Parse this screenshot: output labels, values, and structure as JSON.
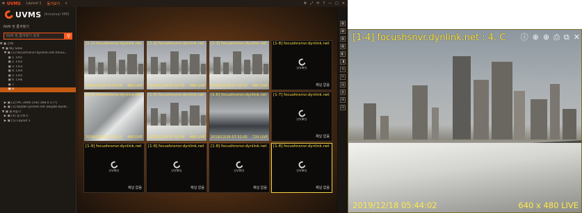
{
  "topbar": {
    "brand": "UVMS",
    "tabs": [
      {
        "label": "Layout 1",
        "active": false
      },
      {
        "label": "동기보기",
        "active": true
      }
    ],
    "add_tab": "+",
    "window_controls": [
      "⚙",
      "⤢",
      "⟳",
      "?",
      "—",
      "□",
      "✕"
    ]
  },
  "sidebar": {
    "logo_text": "UVMS",
    "logo_sub": "Universal VMS",
    "section_label": "NVR 및 즐겨찾기",
    "search_placeholder": "NVR 및 즐겨찾기 검색",
    "tree": [
      "▼ ▣ 전체",
      "  ▼ ▣ My Sites",
      "    ▼ ▣ [1] focushnsnvr.dynlink.net (focus...",
      "        ▣ 1. CH1",
      "        ▣ 2. CH2",
      "        ▣ 3. CH3",
      "        ▣ 4. CH4",
      "        ▣ 5. CH5",
      "        ▣ 6. CH6",
      "        ▣ 7.",
      "        ▣ 8.",
      "",
      "",
      "    ▶ ▣ [2] IPC-3000 (192.168.0.177)",
      "    ▶ ▣ [3] bkjdat.synheit.net (bkjdat.dynlk...",
      "  ▼ ▣ 즐겨찾기",
      "    ▶ ▣ [4] 동기보기",
      "    ▶ ▣ [5] Layout 1"
    ],
    "selected_index": 10
  },
  "grid": {
    "cells": [
      {
        "title": "[1-1] focushnsnvr.dynlink.net",
        "time": "2019/12/26 07:52:05",
        "res": "480 LIVE",
        "kind": "rooftop"
      },
      {
        "title": "[1-2] focushnsnvr.dynlink.net",
        "time": "2019/12/26 07:52:05",
        "res": "480 LIVE",
        "kind": "rooftop"
      },
      {
        "title": "[1-3] focushnsnvr.dynlink.net",
        "time": "2019/12/26 07:52:05",
        "res": "480 LIVE",
        "kind": "rooftop"
      },
      {
        "title": "[1-8] focushnsnvr.dynlink.net",
        "nosignal": "채널 없음",
        "kind": "empty"
      },
      {
        "title": "[1-5] focushnsnvr.dynlink.net",
        "time": "2019/12/26 07:52:05",
        "res": "480 LIVE",
        "kind": "indoor"
      },
      {
        "title": "[1-5] focushnsnvr.dynlink.net",
        "time": "2019/12/26 07:52:05",
        "res": "480 LIVE",
        "kind": "rooftop"
      },
      {
        "title": "[1-6] focushnsnvr.dynlink.net",
        "time": "2019/12/26 07:52:05",
        "res": "720 LIVE",
        "kind": "office"
      },
      {
        "title": "[1-7] focushnsnvr.dynlink.net",
        "nosignal": "채널 없음",
        "kind": "empty"
      },
      {
        "title": "[1-9] focushnsnvr.dynlink.net",
        "nosignal": "채널 없음",
        "kind": "empty"
      },
      {
        "title": "[1-9] focushnsnvr.dynlink.net",
        "nosignal": "채널 없음",
        "kind": "empty"
      },
      {
        "title": "[1-8] focushnsnvr.dynlink.net",
        "nosignal": "채널 없음",
        "kind": "empty"
      },
      {
        "title": "[1-8] focushnsnvr.dynlink.net",
        "nosignal": "채널 없음",
        "kind": "empty",
        "selected": true
      }
    ],
    "placeholder_text": "UVMS"
  },
  "right_toolbar": [
    "▦",
    "▦",
    "▦",
    "▦",
    "◧",
    "◨",
    "⟲",
    "⟳",
    "▤",
    "▥",
    "⊞",
    "⊟"
  ],
  "enlarged": {
    "title": "[1-4] focushsnvr.dynlink.net : 4. C",
    "time": "2019/12/18 05:44:02",
    "res": "640 x 480  LIVE",
    "controls": [
      {
        "name": "info-icon",
        "glyph": "ⓘ"
      },
      {
        "name": "ptz-icon",
        "glyph": "⊕"
      },
      {
        "name": "zoom-icon",
        "glyph": "⊕"
      },
      {
        "name": "print-icon",
        "glyph": "⎙"
      },
      {
        "name": "copy-icon",
        "glyph": "⧉"
      },
      {
        "name": "close-icon",
        "glyph": "✕"
      }
    ]
  }
}
